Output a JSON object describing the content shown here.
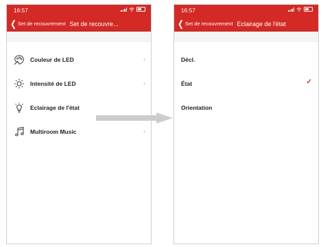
{
  "left_screen": {
    "status_time": "16:57",
    "back_label": "Set de recouvrement",
    "title": "Set de recouvre...",
    "items": [
      {
        "label": "Couleur de LED",
        "icon": "palette-icon"
      },
      {
        "label": "Intensité de LED",
        "icon": "brightness-icon"
      },
      {
        "label": "Eclairage de l'état",
        "icon": "bulb-icon"
      },
      {
        "label": "Multiroom Music",
        "icon": "music-note-icon"
      }
    ]
  },
  "right_screen": {
    "status_time": "16:57",
    "back_label": "Set de recouvrement",
    "title": "Eclairage de l'état",
    "options": [
      {
        "label": "Décl.",
        "selected": false
      },
      {
        "label": "État",
        "selected": true
      },
      {
        "label": "Orientation",
        "selected": false
      }
    ]
  },
  "colors": {
    "accent": "#d32a26",
    "arrow": "#cccccc"
  }
}
